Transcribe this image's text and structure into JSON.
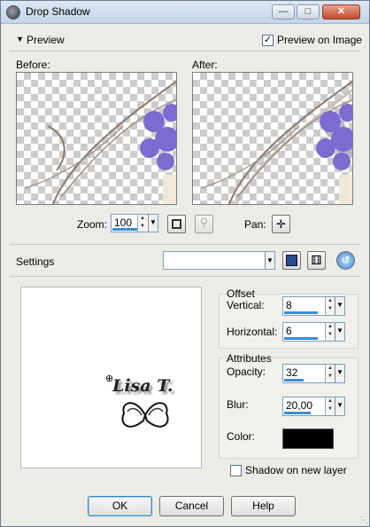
{
  "window": {
    "title": "Drop Shadow",
    "minimize_icon": "minimize-icon",
    "maximize_icon": "maximize-icon",
    "close_icon": "close-icon"
  },
  "preview": {
    "section_label": "Preview",
    "preview_on_image_label": "Preview on Image",
    "preview_on_image_checked": true,
    "before_label": "Before:",
    "after_label": "After:",
    "zoom_label": "Zoom:",
    "zoom_value": "100",
    "pan_label": "Pan:"
  },
  "settings": {
    "label": "Settings",
    "value": ""
  },
  "offset": {
    "title": "Offset",
    "vertical_label": "Vertical:",
    "vertical_value": "8",
    "horizontal_label": "Horizontal:",
    "horizontal_value": "6"
  },
  "attributes": {
    "title": "Attributes",
    "opacity_label": "Opacity:",
    "opacity_value": "32",
    "blur_label": "Blur:",
    "blur_value": "20,00",
    "color_label": "Color:",
    "color": "#000000",
    "shadow_on_new_layer_label": "Shadow on new layer",
    "shadow_on_new_layer_checked": false
  },
  "watermark_text": "Lisa T.",
  "buttons": {
    "ok": "OK",
    "cancel": "Cancel",
    "help": "Help"
  }
}
